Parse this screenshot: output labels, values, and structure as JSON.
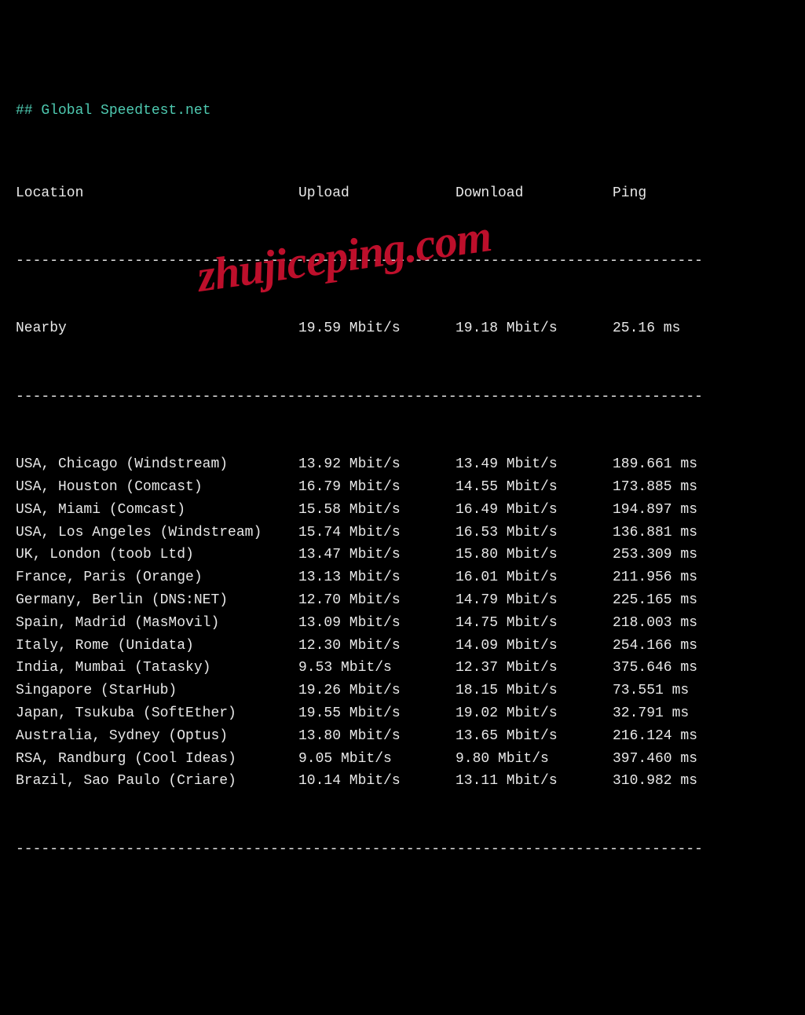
{
  "title": "## Global Speedtest.net",
  "headers": {
    "location": "Location",
    "upload": "Upload",
    "download": "Download",
    "ping": "Ping"
  },
  "divider": "---------------------------------------------------------------------------------",
  "nearby": {
    "location": "Nearby",
    "upload": "19.59 Mbit/s",
    "download": "19.18 Mbit/s",
    "ping": "25.16 ms"
  },
  "rows": [
    {
      "location": "USA, Chicago (Windstream)",
      "upload": "13.92 Mbit/s",
      "download": "13.49 Mbit/s",
      "ping": "189.661 ms"
    },
    {
      "location": "USA, Houston (Comcast)",
      "upload": "16.79 Mbit/s",
      "download": "14.55 Mbit/s",
      "ping": "173.885 ms"
    },
    {
      "location": "USA, Miami (Comcast)",
      "upload": "15.58 Mbit/s",
      "download": "16.49 Mbit/s",
      "ping": "194.897 ms"
    },
    {
      "location": "USA, Los Angeles (Windstream)",
      "upload": "15.74 Mbit/s",
      "download": "16.53 Mbit/s",
      "ping": "136.881 ms"
    },
    {
      "location": "UK, London (toob Ltd)",
      "upload": "13.47 Mbit/s",
      "download": "15.80 Mbit/s",
      "ping": "253.309 ms"
    },
    {
      "location": "France, Paris (Orange)",
      "upload": "13.13 Mbit/s",
      "download": "16.01 Mbit/s",
      "ping": "211.956 ms"
    },
    {
      "location": "Germany, Berlin (DNS:NET)",
      "upload": "12.70 Mbit/s",
      "download": "14.79 Mbit/s",
      "ping": "225.165 ms"
    },
    {
      "location": "Spain, Madrid (MasMovil)",
      "upload": "13.09 Mbit/s",
      "download": "14.75 Mbit/s",
      "ping": "218.003 ms"
    },
    {
      "location": "Italy, Rome (Unidata)",
      "upload": "12.30 Mbit/s",
      "download": "14.09 Mbit/s",
      "ping": "254.166 ms"
    },
    {
      "location": "India, Mumbai (Tatasky)",
      "upload": "9.53 Mbit/s",
      "download": "12.37 Mbit/s",
      "ping": "375.646 ms"
    },
    {
      "location": "Singapore (StarHub)",
      "upload": "19.26 Mbit/s",
      "download": "18.15 Mbit/s",
      "ping": "73.551 ms"
    },
    {
      "location": "Japan, Tsukuba (SoftEther)",
      "upload": "19.55 Mbit/s",
      "download": "19.02 Mbit/s",
      "ping": "32.791 ms"
    },
    {
      "location": "Australia, Sydney (Optus)",
      "upload": "13.80 Mbit/s",
      "download": "13.65 Mbit/s",
      "ping": "216.124 ms"
    },
    {
      "location": "RSA, Randburg (Cool Ideas)",
      "upload": "9.05 Mbit/s",
      "download": "9.80 Mbit/s",
      "ping": "397.460 ms"
    },
    {
      "location": "Brazil, Sao Paulo (Criare)",
      "upload": "10.14 Mbit/s",
      "download": "13.11 Mbit/s",
      "ping": "310.982 ms"
    }
  ],
  "watermark": "zhujiceping.com",
  "chart_data": {
    "type": "table",
    "title": "Global Speedtest.net",
    "columns": [
      "Location",
      "Upload",
      "Download",
      "Ping"
    ],
    "rows": [
      [
        "Nearby",
        "19.59 Mbit/s",
        "19.18 Mbit/s",
        "25.16 ms"
      ],
      [
        "USA, Chicago (Windstream)",
        "13.92 Mbit/s",
        "13.49 Mbit/s",
        "189.661 ms"
      ],
      [
        "USA, Houston (Comcast)",
        "16.79 Mbit/s",
        "14.55 Mbit/s",
        "173.885 ms"
      ],
      [
        "USA, Miami (Comcast)",
        "15.58 Mbit/s",
        "16.49 Mbit/s",
        "194.897 ms"
      ],
      [
        "USA, Los Angeles (Windstream)",
        "15.74 Mbit/s",
        "16.53 Mbit/s",
        "136.881 ms"
      ],
      [
        "UK, London (toob Ltd)",
        "13.47 Mbit/s",
        "15.80 Mbit/s",
        "253.309 ms"
      ],
      [
        "France, Paris (Orange)",
        "13.13 Mbit/s",
        "16.01 Mbit/s",
        "211.956 ms"
      ],
      [
        "Germany, Berlin (DNS:NET)",
        "12.70 Mbit/s",
        "14.79 Mbit/s",
        "225.165 ms"
      ],
      [
        "Spain, Madrid (MasMovil)",
        "13.09 Mbit/s",
        "14.75 Mbit/s",
        "218.003 ms"
      ],
      [
        "Italy, Rome (Unidata)",
        "12.30 Mbit/s",
        "14.09 Mbit/s",
        "254.166 ms"
      ],
      [
        "India, Mumbai (Tatasky)",
        "9.53 Mbit/s",
        "12.37 Mbit/s",
        "375.646 ms"
      ],
      [
        "Singapore (StarHub)",
        "19.26 Mbit/s",
        "18.15 Mbit/s",
        "73.551 ms"
      ],
      [
        "Japan, Tsukuba (SoftEther)",
        "19.55 Mbit/s",
        "19.02 Mbit/s",
        "32.791 ms"
      ],
      [
        "Australia, Sydney (Optus)",
        "13.80 Mbit/s",
        "13.65 Mbit/s",
        "216.124 ms"
      ],
      [
        "RSA, Randburg (Cool Ideas)",
        "9.05 Mbit/s",
        "9.80 Mbit/s",
        "397.460 ms"
      ],
      [
        "Brazil, Sao Paulo (Criare)",
        "10.14 Mbit/s",
        "13.11 Mbit/s",
        "310.982 ms"
      ]
    ]
  }
}
